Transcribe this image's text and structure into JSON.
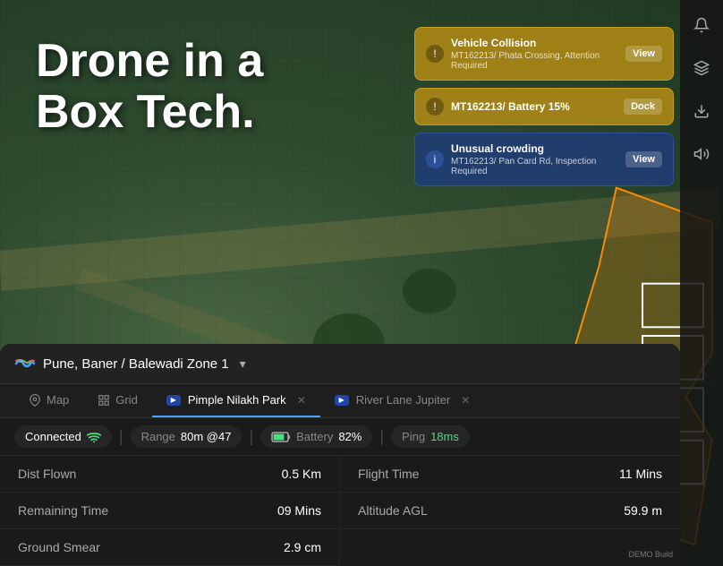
{
  "app": {
    "title": "Drone in a Box Tech.",
    "title_line1": "Drone in a",
    "title_line2": "Box Tech."
  },
  "location": {
    "zone": "Pune, Baner / Balewadi Zone 1"
  },
  "tabs": {
    "map_label": "Map",
    "grid_label": "Grid",
    "tab1_label": "Pimple Nilakh Park",
    "tab2_label": "River Lane Jupiter"
  },
  "alerts": [
    {
      "type": "yellow",
      "icon": "!",
      "title": "Vehicle Collision",
      "subtitle": "MT162213/ Phata Crossing, Attention Required",
      "action": "View"
    },
    {
      "type": "yellow",
      "icon": "!",
      "title": "MT162213/ Battery 15%",
      "subtitle": "",
      "action": "Dock"
    },
    {
      "type": "blue",
      "icon": "i",
      "title": "Unusual crowding",
      "subtitle": "MT162213/ Pan Card Rd, Inspection Required",
      "action": "View"
    }
  ],
  "status": {
    "connected_label": "Connected",
    "range_label": "Range",
    "range_value": "80m @47",
    "battery_label": "Battery",
    "battery_value": "82%",
    "ping_label": "Ping",
    "ping_value": "18ms"
  },
  "stats": [
    {
      "label": "Dist Flown",
      "value": "0.5 Km"
    },
    {
      "label": "Flight Time",
      "value": "11 Mins"
    },
    {
      "label": "Remaining Time",
      "value": "09 Mins"
    },
    {
      "label": "Altitude AGL",
      "value": "59.9 m"
    },
    {
      "label": "Ground Smear",
      "value": "2.9 cm"
    }
  ],
  "watermark": "DEMO Build",
  "sidebar_icons": [
    "bell",
    "layers",
    "download",
    "volume"
  ]
}
